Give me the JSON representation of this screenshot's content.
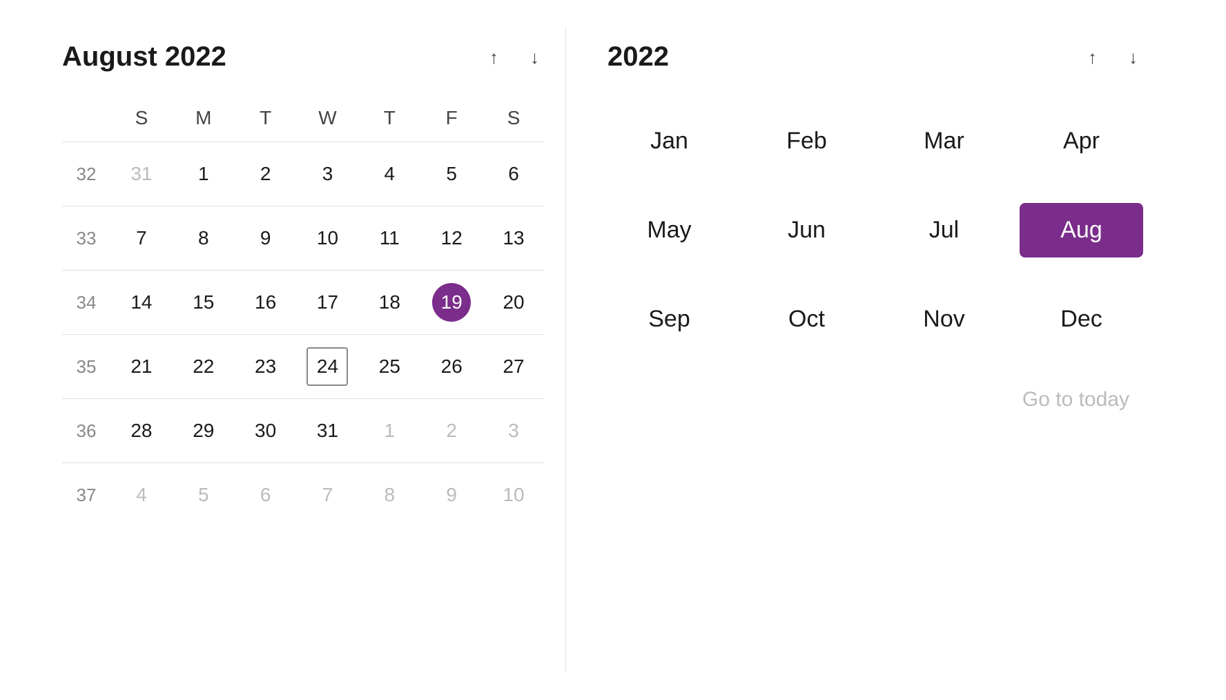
{
  "left": {
    "title": "August 2022",
    "nav_up_label": "↑",
    "nav_down_label": "↓",
    "day_headers": [
      "S",
      "M",
      "T",
      "W",
      "T",
      "F",
      "S"
    ],
    "weeks": [
      {
        "week_num": "32",
        "days": [
          {
            "label": "31",
            "type": "other-month"
          },
          {
            "label": "1",
            "type": "normal"
          },
          {
            "label": "2",
            "type": "normal"
          },
          {
            "label": "3",
            "type": "normal"
          },
          {
            "label": "4",
            "type": "normal"
          },
          {
            "label": "5",
            "type": "normal"
          },
          {
            "label": "6",
            "type": "normal"
          }
        ]
      },
      {
        "week_num": "33",
        "days": [
          {
            "label": "7",
            "type": "normal"
          },
          {
            "label": "8",
            "type": "normal"
          },
          {
            "label": "9",
            "type": "normal"
          },
          {
            "label": "10",
            "type": "normal"
          },
          {
            "label": "11",
            "type": "normal"
          },
          {
            "label": "12",
            "type": "normal"
          },
          {
            "label": "13",
            "type": "normal"
          }
        ]
      },
      {
        "week_num": "34",
        "days": [
          {
            "label": "14",
            "type": "normal"
          },
          {
            "label": "15",
            "type": "normal"
          },
          {
            "label": "16",
            "type": "normal"
          },
          {
            "label": "17",
            "type": "normal"
          },
          {
            "label": "18",
            "type": "normal"
          },
          {
            "label": "19",
            "type": "today"
          },
          {
            "label": "20",
            "type": "normal"
          }
        ]
      },
      {
        "week_num": "35",
        "days": [
          {
            "label": "21",
            "type": "normal"
          },
          {
            "label": "22",
            "type": "normal"
          },
          {
            "label": "23",
            "type": "normal"
          },
          {
            "label": "24",
            "type": "selected"
          },
          {
            "label": "25",
            "type": "normal"
          },
          {
            "label": "26",
            "type": "normal"
          },
          {
            "label": "27",
            "type": "normal"
          }
        ]
      },
      {
        "week_num": "36",
        "days": [
          {
            "label": "28",
            "type": "normal"
          },
          {
            "label": "29",
            "type": "normal"
          },
          {
            "label": "30",
            "type": "normal"
          },
          {
            "label": "31",
            "type": "normal"
          },
          {
            "label": "1",
            "type": "other-month"
          },
          {
            "label": "2",
            "type": "other-month"
          },
          {
            "label": "3",
            "type": "other-month"
          }
        ]
      },
      {
        "week_num": "37",
        "days": [
          {
            "label": "4",
            "type": "other-month"
          },
          {
            "label": "5",
            "type": "other-month"
          },
          {
            "label": "6",
            "type": "other-month"
          },
          {
            "label": "7",
            "type": "other-month"
          },
          {
            "label": "8",
            "type": "other-month"
          },
          {
            "label": "9",
            "type": "other-month"
          },
          {
            "label": "10",
            "type": "other-month"
          }
        ]
      }
    ]
  },
  "right": {
    "title": "2022",
    "nav_up_label": "↑",
    "nav_down_label": "↓",
    "months": [
      {
        "label": "Jan",
        "active": false
      },
      {
        "label": "Feb",
        "active": false
      },
      {
        "label": "Mar",
        "active": false
      },
      {
        "label": "Apr",
        "active": false
      },
      {
        "label": "May",
        "active": false
      },
      {
        "label": "Jun",
        "active": false
      },
      {
        "label": "Jul",
        "active": false
      },
      {
        "label": "Aug",
        "active": true
      },
      {
        "label": "Sep",
        "active": false
      },
      {
        "label": "Oct",
        "active": false
      },
      {
        "label": "Nov",
        "active": false
      },
      {
        "label": "Dec",
        "active": false
      }
    ],
    "go_to_today_label": "Go to today"
  }
}
